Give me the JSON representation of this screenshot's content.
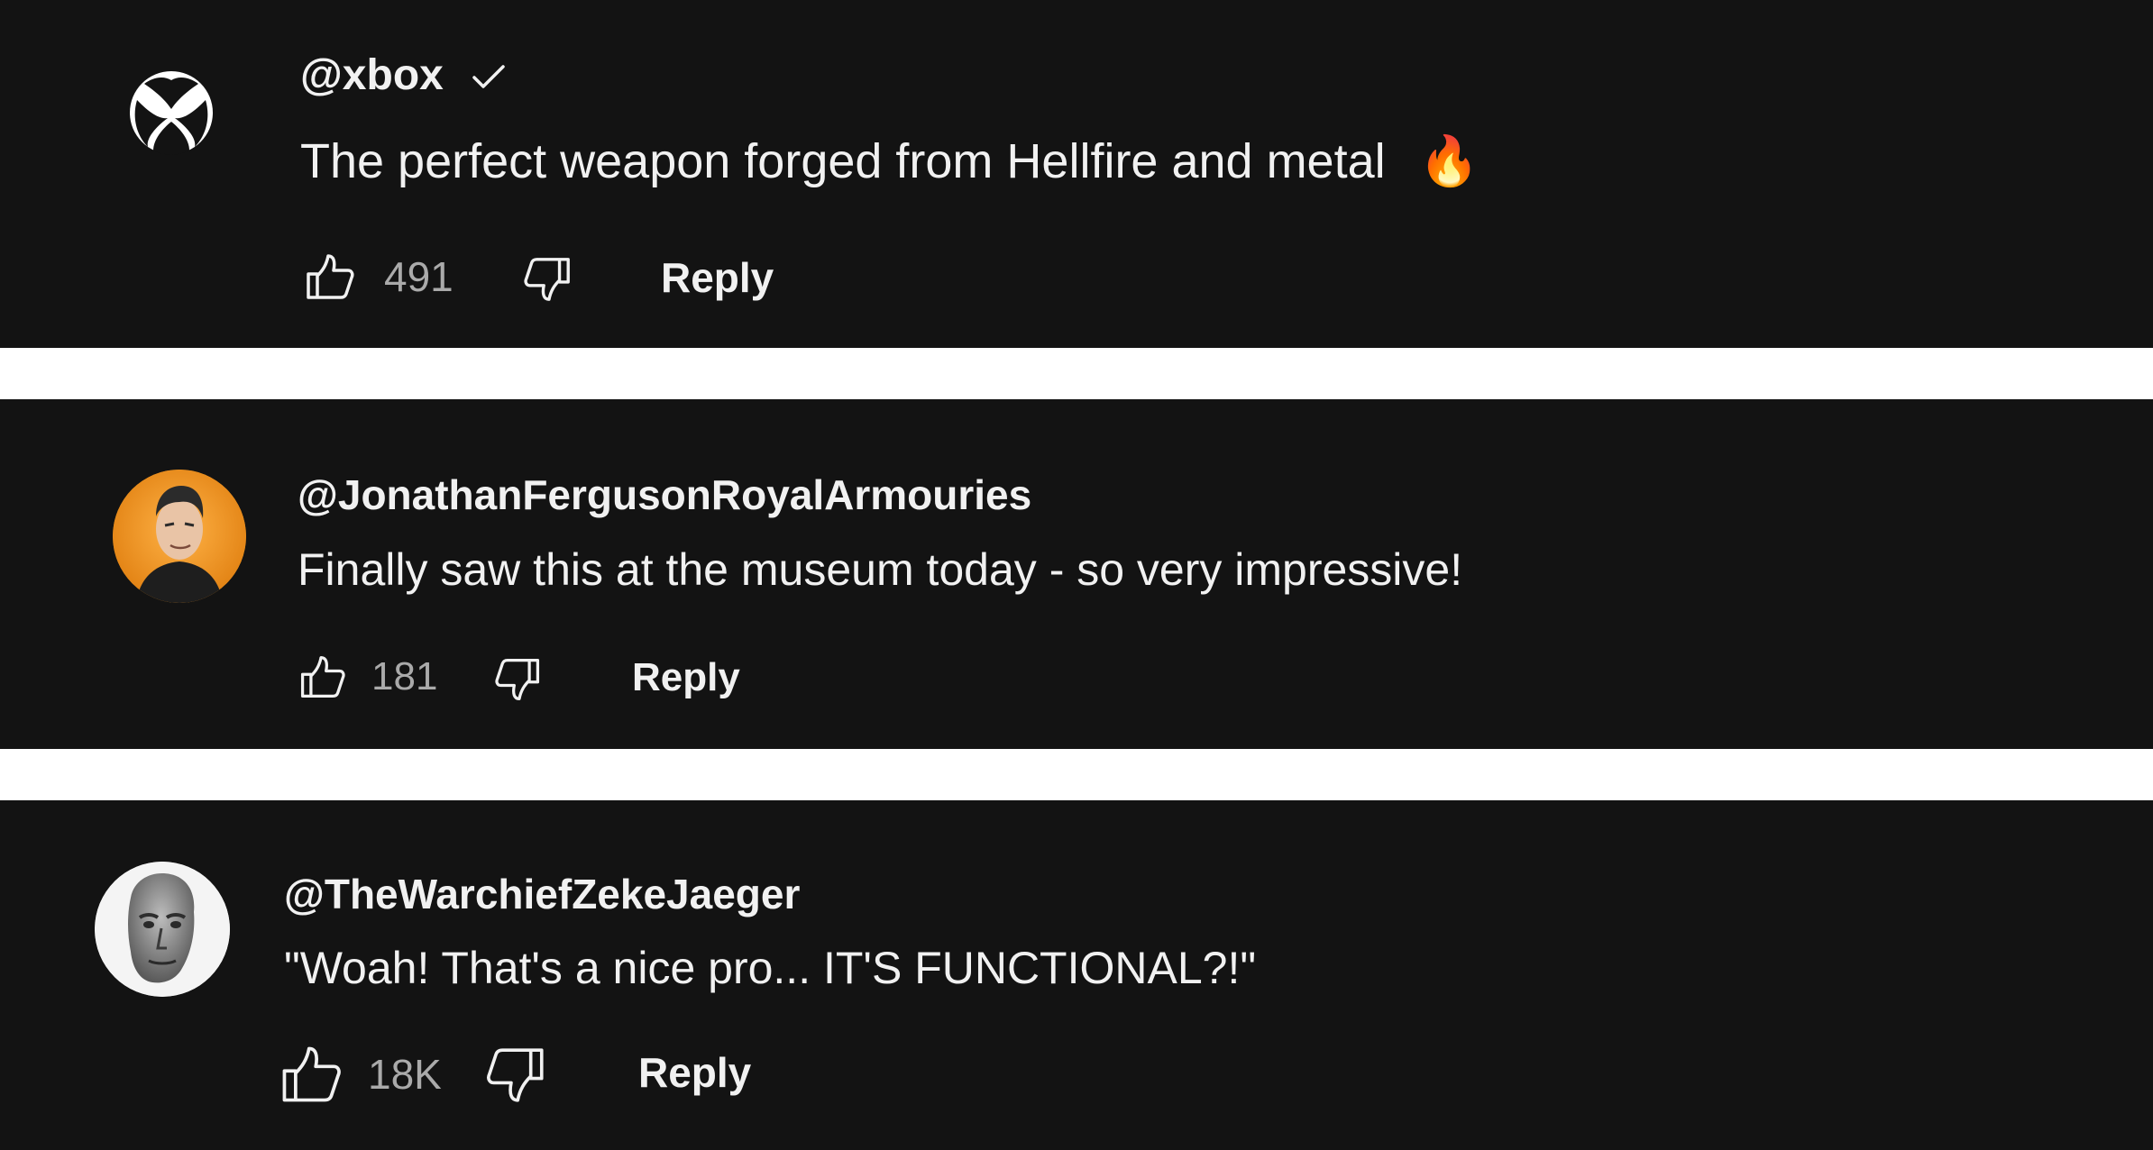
{
  "comments": [
    {
      "handle": "@xbox",
      "verified": true,
      "text": "The perfect weapon forged from Hellfire and metal",
      "emoji": "🔥",
      "likes": "491",
      "reply_label": "Reply",
      "avatar_icon": "xbox-logo-icon"
    },
    {
      "handle": "@JonathanFergusonRoyalArmouries",
      "verified": false,
      "text": "Finally saw this at the museum today - so very impressive!",
      "likes": "181",
      "reply_label": "Reply",
      "avatar_icon": "cartoon-man-avatar"
    },
    {
      "handle": "@TheWarchiefZekeJaeger",
      "verified": false,
      "text": "\"Woah! That's a nice pro... IT'S FUNCTIONAL?!\"",
      "likes": "18K",
      "reply_label": "Reply",
      "avatar_icon": "stone-statue-avatar"
    }
  ],
  "colors": {
    "background": "#131313",
    "separator": "#ffffff",
    "text": "#f1f1f1",
    "count": "#aaaaaa",
    "avatar_orange": "#f39a1e"
  }
}
